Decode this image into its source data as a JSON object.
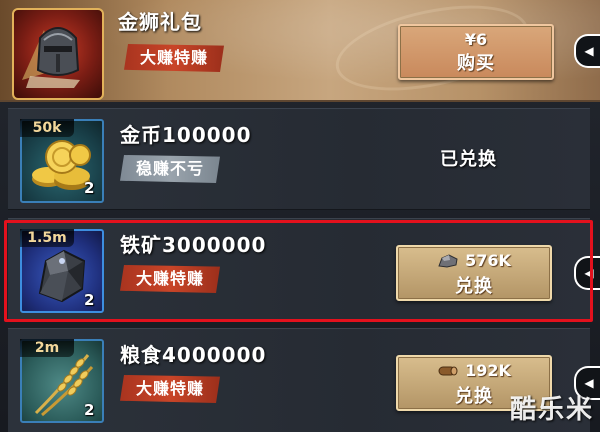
{
  "gift_pack": {
    "title": "金狮礼包",
    "tag": "大赚特赚",
    "price": "¥6",
    "buy_label": "购买"
  },
  "items": [
    {
      "title": "金币100000",
      "tag": "稳赚不亏",
      "qty_tag": "50k",
      "count": "2",
      "status": "已兑换"
    },
    {
      "title": "铁矿3000000",
      "tag": "大赚特赚",
      "qty_tag": "1.5m",
      "count": "2",
      "cost": "576K",
      "button_label": "兑换"
    },
    {
      "title": "粮食4000000",
      "tag": "大赚特赚",
      "qty_tag": "2m",
      "count": "2",
      "cost": "192K",
      "button_label": "兑换"
    }
  ],
  "watermark": "酷乐米",
  "colors": {
    "highlight": "#e3111d",
    "tag_red": "#c94528",
    "tag_grey": "#9aa4ad",
    "button": "#c7a877"
  },
  "icons": [
    "helmet-icon",
    "gold-coins-icon",
    "iron-ore-icon",
    "wheat-icon",
    "ore-stone-icon",
    "wood-log-icon",
    "chevron-icon"
  ]
}
